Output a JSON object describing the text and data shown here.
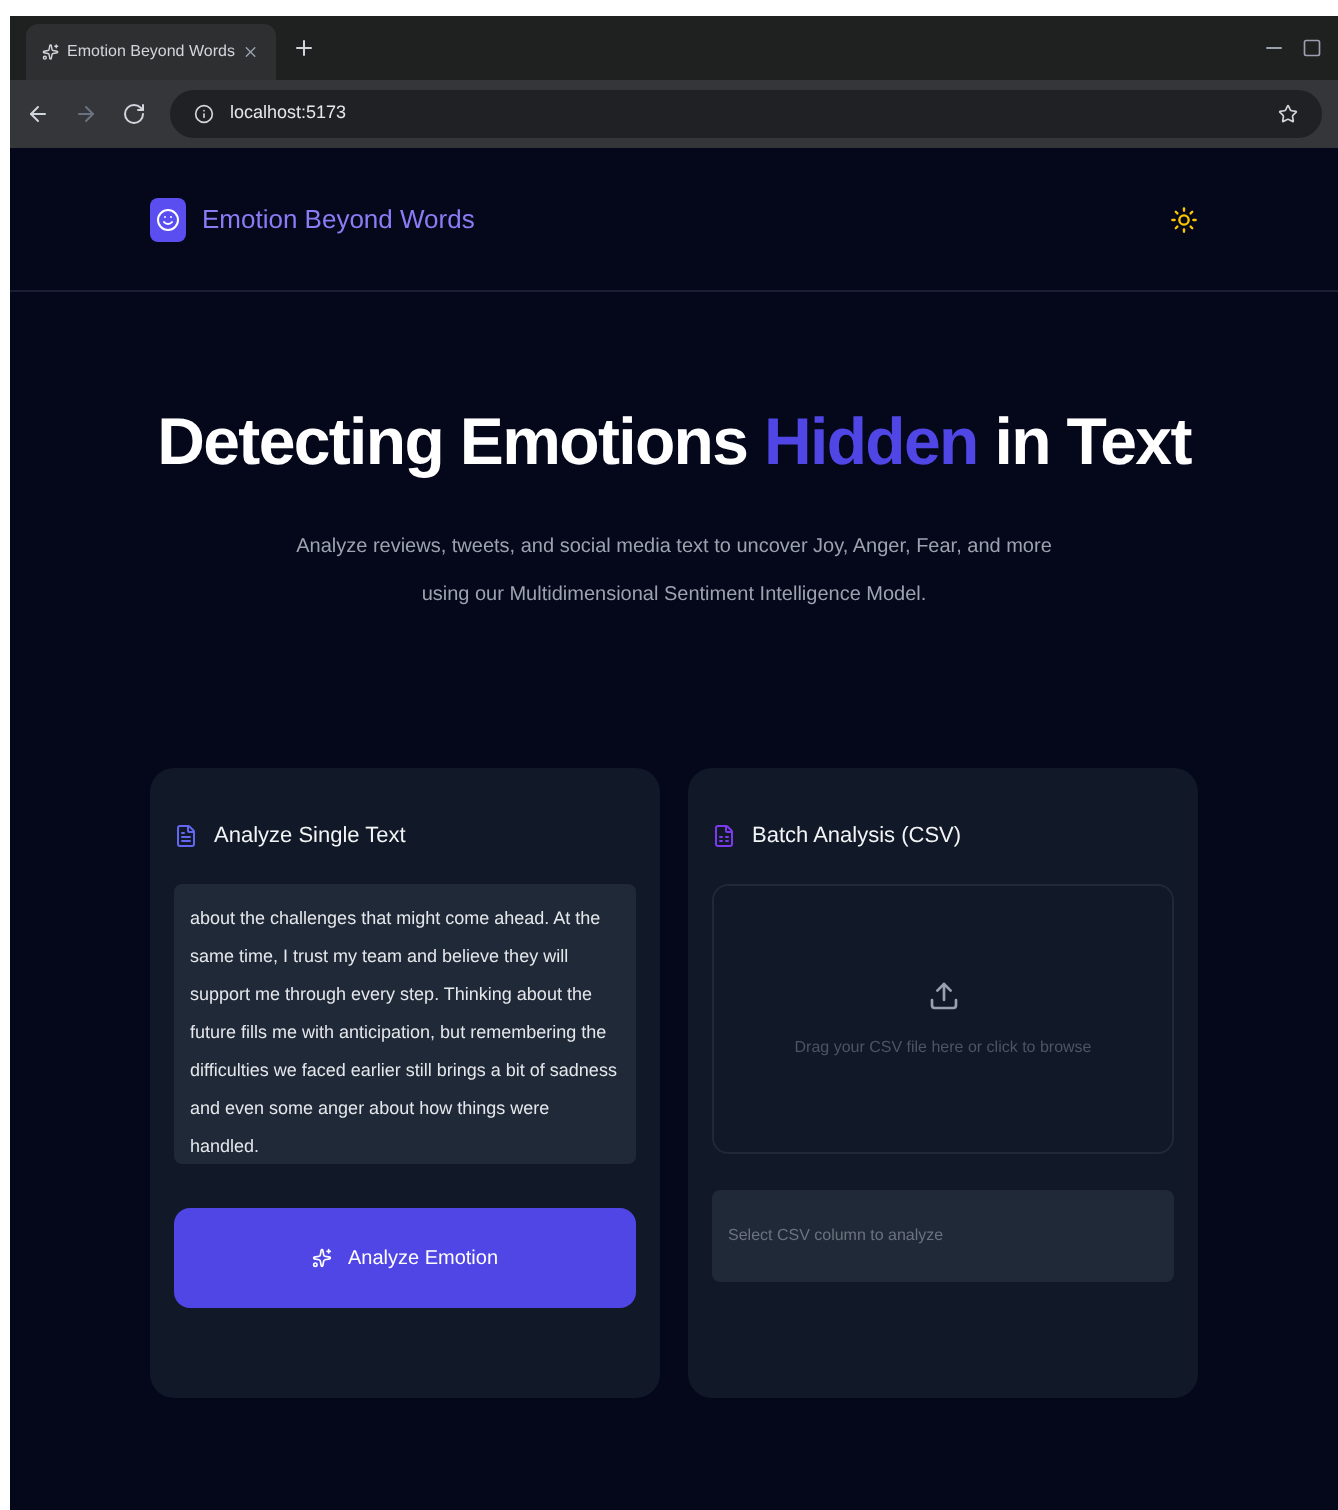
{
  "browser": {
    "tab_title": "Emotion Beyond Words",
    "url": "localhost:5173"
  },
  "header": {
    "brand": "Emotion Beyond Words"
  },
  "hero": {
    "title_start": "Detecting Emotions",
    "title_highlight": "Hidden",
    "title_end": "in Text",
    "subtitle": "Analyze reviews, tweets, and social media text to uncover Joy, Anger, Fear, and more using our Multidimensional Sentiment Intelligence Model."
  },
  "single": {
    "title": "Analyze Single Text",
    "value": "about the challenges that might come ahead. At the same time, I trust my team and believe they will support me through every step. Thinking about the future fills me with anticipation, but remembering the difficulties we faced earlier still brings a bit of sadness and even some anger about how things were handled.",
    "button": "Analyze Emotion"
  },
  "batch": {
    "title": "Batch Analysis (CSV)",
    "drop_hint": "Drag your CSV file here or click to browse",
    "column_placeholder": "Select CSV column to analyze"
  }
}
